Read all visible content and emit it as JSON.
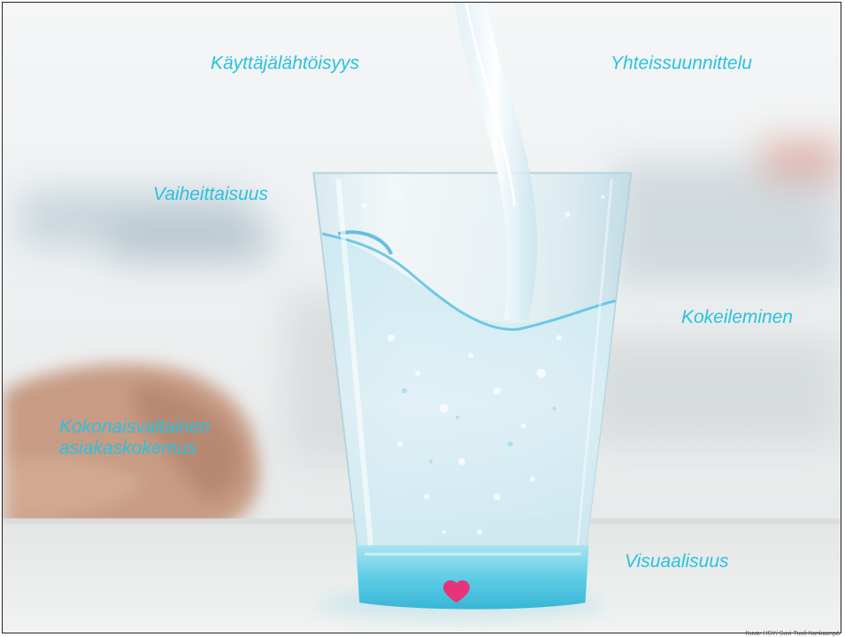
{
  "slide": {
    "words": [
      "Käyttäjälähtöisyys",
      "Yhteissuunnittelu",
      "Vaiheittaisuus",
      "Kokeileminen",
      "Kokonaisvaltainen asiakaskokemus",
      "Visuaalisuus"
    ],
    "credit": "Kuva: HSY/ Suvi-Tuuli Kankaanpä"
  },
  "colors": {
    "text_accent": "#29c2e0",
    "heart": "#e6337a",
    "glass": "#6fd0e6"
  },
  "icons": {
    "heart": "heart-icon"
  }
}
